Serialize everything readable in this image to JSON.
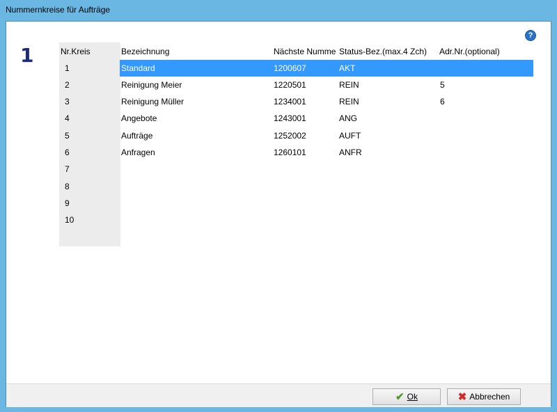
{
  "window": {
    "title": "Nummernkreise für Aufträge"
  },
  "page": {
    "number": "1",
    "help_icon": "question-icon"
  },
  "grid": {
    "columns": [
      "Nr.Kreis",
      "Bezeichnung",
      "Nächste Numme",
      "Status-Bez.(max.4 Zch)",
      "Adr.Nr.(optional)"
    ],
    "row_numbers": [
      "1",
      "2",
      "3",
      "4",
      "5",
      "6",
      "7",
      "8",
      "9",
      "10"
    ],
    "rows": [
      {
        "bezeichnung": "Standard",
        "naechste": "1200607",
        "status": "AKT",
        "adr": ""
      },
      {
        "bezeichnung": "Reinigung Meier",
        "naechste": "1220501",
        "status": "REIN",
        "adr": "5"
      },
      {
        "bezeichnung": "Reinigung Müller",
        "naechste": "1234001",
        "status": "REIN",
        "adr": "6"
      },
      {
        "bezeichnung": "Angebote",
        "naechste": "1243001",
        "status": "ANG",
        "adr": ""
      },
      {
        "bezeichnung": "Aufträge",
        "naechste": "1252002",
        "status": "AUFT",
        "adr": ""
      },
      {
        "bezeichnung": "Anfragen",
        "naechste": "1260101",
        "status": "ANFR",
        "adr": ""
      }
    ],
    "selected_row": 0
  },
  "buttons": {
    "ok_label": "Ok",
    "cancel_label": "Abbrechen"
  }
}
